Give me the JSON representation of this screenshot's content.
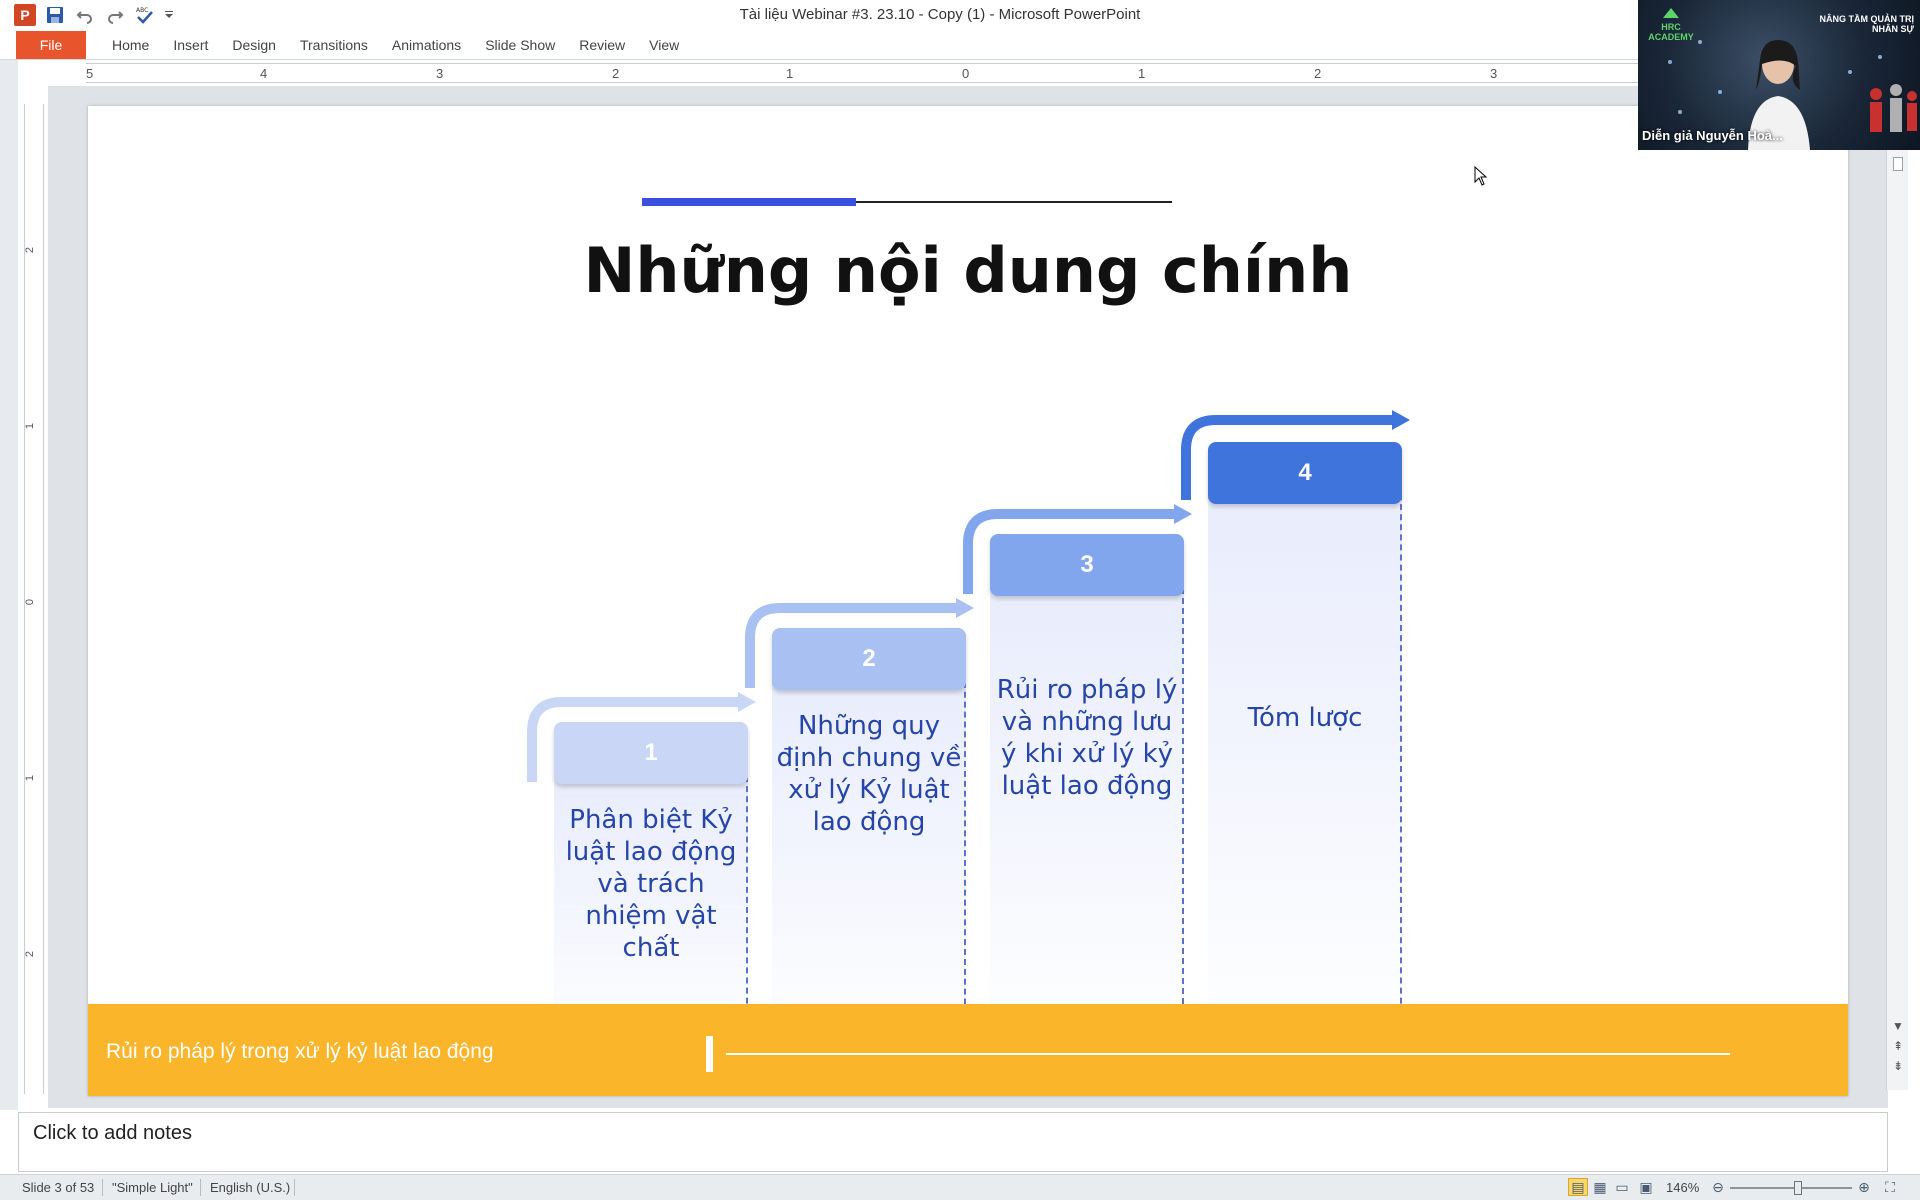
{
  "window": {
    "title": "Tài liệu Webinar #3. 23.10 - Copy (1) - Microsoft PowerPoint",
    "app_icon_letter": "P"
  },
  "quick_access": [
    {
      "name": "save-icon",
      "glyph": "💾"
    },
    {
      "name": "undo-icon",
      "glyph": "↶"
    },
    {
      "name": "redo-icon",
      "glyph": "↷"
    },
    {
      "name": "spelling-icon",
      "glyph": "✔"
    },
    {
      "name": "customize-qat-icon",
      "glyph": "▾"
    }
  ],
  "ribbon": {
    "file_label": "File",
    "tabs": [
      "Home",
      "Insert",
      "Design",
      "Transitions",
      "Animations",
      "Slide Show",
      "Review",
      "View"
    ]
  },
  "ruler": {
    "h_labels": [
      "5",
      "4",
      "3",
      "2",
      "1",
      "0",
      "1",
      "2",
      "3"
    ],
    "v_labels": [
      "2",
      "1",
      "0",
      "1",
      "2"
    ]
  },
  "slide": {
    "title": "Những nội dung chính",
    "steps": [
      {
        "number": "1",
        "text": "Phân biệt Kỷ luật lao động và trách nhiệm vật chất",
        "color": "#c9d6f5"
      },
      {
        "number": "2",
        "text": "Những quy định chung về xử lý Kỷ luật lao động",
        "color": "#a9c0f2"
      },
      {
        "number": "3",
        "text": "Rủi ro pháp lý và những lưu ý khi xử lý kỷ luật lao động",
        "color": "#82a6ee"
      },
      {
        "number": "4",
        "text": "Tóm lược",
        "color": "#3f74dc"
      }
    ],
    "footer_text": "Rủi ro pháp lý trong xử lý kỷ luật lao động",
    "colors": {
      "accent_blue": "#3a50e0",
      "footer_yellow": "#fbb52b",
      "step_text": "#2546a8"
    }
  },
  "notes": {
    "placeholder": "Click to add notes"
  },
  "status": {
    "slide_info": "Slide 3 of 53",
    "theme": "\"Simple Light\"",
    "language": "English (U.S.)",
    "zoom": "146%"
  },
  "video": {
    "caption": "Diễn giả Nguyễn Hoà...",
    "headline": "NÂNG TẦM QUẢN TRỊ NHÂN SỰ",
    "logo_text": "HRC ACADEMY"
  }
}
